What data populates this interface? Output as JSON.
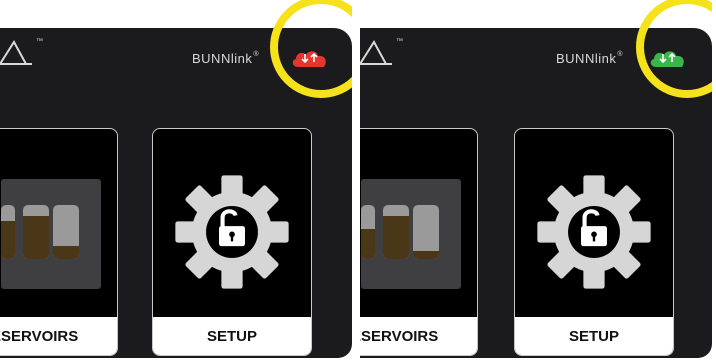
{
  "brand": {
    "name": "BUNNlink",
    "registered": "®",
    "trademark": "™"
  },
  "panels": [
    {
      "sync_status": "red",
      "sync_color": "#e2362f",
      "cards": [
        {
          "label": "ESERVOIRS",
          "icon": "reservoir-bins-icon",
          "levels": [
            0.75,
            0.9,
            0.3
          ]
        },
        {
          "label": "SETUP",
          "icon": "gear-lock-icon"
        }
      ]
    },
    {
      "sync_status": "green",
      "sync_color": "#39b54a",
      "cards": [
        {
          "label": "ESERVOIRS",
          "icon": "reservoir-bins-icon",
          "levels": [
            0.55,
            0.8,
            0.15
          ]
        },
        {
          "label": "SETUP",
          "icon": "gear-lock-icon"
        }
      ]
    }
  ],
  "highlight_color": "#f6e21a"
}
